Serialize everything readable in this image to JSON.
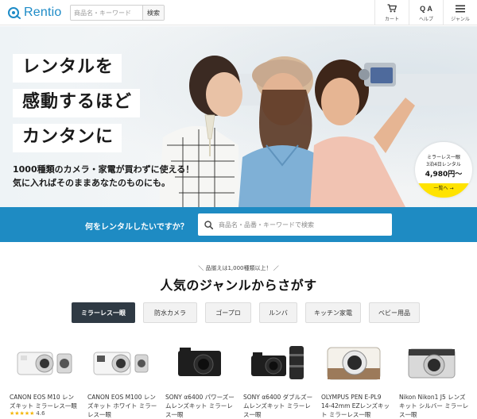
{
  "header": {
    "logo_text": "Rentio",
    "search_placeholder": "商品名・キーワード",
    "search_button": "検索",
    "icons": [
      {
        "name": "cart-icon",
        "label": "カート"
      },
      {
        "name": "help-icon",
        "glyph": "Q A",
        "label": "ヘルプ"
      },
      {
        "name": "menu-icon",
        "label": "ジャンル"
      }
    ]
  },
  "hero": {
    "lines": [
      "レンタルを",
      "感動するほど",
      "カンタンに"
    ],
    "sub1": "1000種類のカメラ・家電が買わずに使える！",
    "sub2": "気に入ればそのままあなたのものにも。",
    "promo": {
      "line1": "ミラーレス一眼",
      "line2": "3泊4日レンタル",
      "price": "4,980円〜",
      "cta": "一覧へ →"
    }
  },
  "band": {
    "label": "何をレンタルしたいですか？",
    "placeholder": "商品名・品番・キーワードで検索"
  },
  "genres": {
    "note": "品揃えは1,000種類以上！",
    "title": "人気のジャンルからさがす",
    "tabs": [
      "ミラーレス一眼",
      "防水カメラ",
      "ゴープロ",
      "ルンバ",
      "キッチン家電",
      "ベビー用品"
    ],
    "active_index": 0
  },
  "products": [
    {
      "name": "CANON EOS M10 レンズキット ミラーレス一眼",
      "stars": "★★★★★",
      "rating": "4.6"
    },
    {
      "name": "CANON EOS M100 レンズキット ホワイト ミラーレス一眼"
    },
    {
      "name": "SONY α6400 パワーズームレンズキット ミラーレス一眼"
    },
    {
      "name": "SONY α6400 ダブルズームレンズキット ミラーレス一眼"
    },
    {
      "name": "OLYMPUS PEN E-PL9 14-42mm EZレンズキット ミラーレス一眼"
    },
    {
      "name": "Nikon Nikon1 J5 レンズキット シルバー ミラーレス一眼"
    }
  ],
  "colors": {
    "brand": "#1d8bc7",
    "band": "#1e8bc3",
    "active_tab": "#2f3a44",
    "promo_yellow": "#ffe300",
    "star": "#f4b400"
  }
}
